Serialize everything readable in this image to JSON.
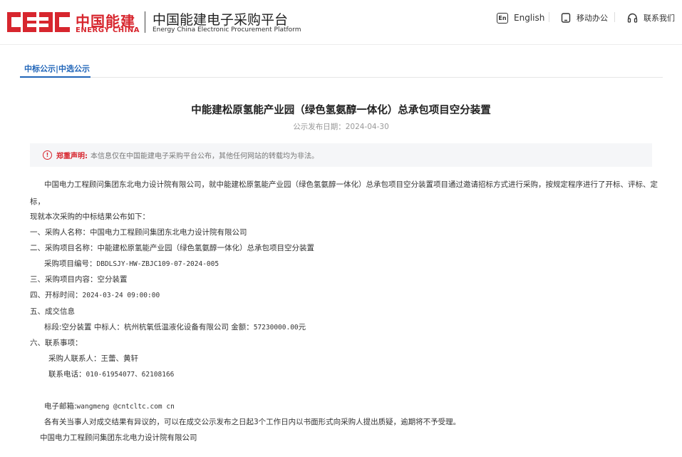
{
  "header": {
    "brand_cn": "中国能建",
    "brand_en": "ENERGY CHINA",
    "platform_cn": "中国能建电子采购平台",
    "platform_en": "Energy China Electronic Procurement Platform",
    "nav": [
      {
        "label": "English",
        "icon": "en-icon"
      },
      {
        "label": "移动办公",
        "icon": "mobile-icon"
      },
      {
        "label": "联系我们",
        "icon": "headset-icon"
      }
    ],
    "brand_color": "#d7262e"
  },
  "tabs": [
    {
      "label": "中标公示|中选公示",
      "active": true
    }
  ],
  "article": {
    "title": "中能建松原氢能产业园（绿色氢氨醇一体化）总承包项目空分装置",
    "pub_date_label": "公示发布日期：",
    "pub_date": "2024-04-30",
    "notice_label": "郑重声明:",
    "notice_text": "本信息仅在中国能建电子采购平台公布，其他任何网站的转载均为非法。",
    "intro_1": "中国电力工程顾问集团东北电力设计院有限公司，就中能建松原氢能产业园（绿色氢氨醇一体化）总承包项目空分装置项目通过邀请招标方式进行采购，按规定程序进行了开标、评标、定",
    "intro_2": "标，",
    "intro_3": "现就本次采购的中标结果公布如下：",
    "item_1": "一、采购人名称：中国电力工程顾问集团东北电力设计院有限公司",
    "item_2": "二、采购项目名称：中能建松原氢能产业园（绿色氢氨醇一体化）总承包项目空分装置",
    "item_2_code_label": "采购项目编号：",
    "item_2_code": "DBDLSJY-HW-ZBJC109-07-2024-005",
    "item_3": "三、采购项目内容：空分装置",
    "item_4_label": "四、开标时间：",
    "item_4_time": "2024-03-24 09:00:00",
    "item_5": "五、成交信息",
    "item_5_detail_a": "标段:空分装置   中标人：杭州杭氧低温液化设备有限公司 金额：",
    "item_5_amount": "57230000.00",
    "item_5_unit": "元",
    "item_6": "六、联系事项：",
    "contact_person": "采购人联系人：王蕾、黄轩",
    "contact_phone_label": "联系电话：",
    "contact_phone": "010-61954077、62108166",
    "email_label": "电子邮箱:",
    "email": "wangmeng @cntcltc.com cn",
    "objection": "各有关当事人对成交结果有异议的，可以在成交公示发布之日起3个工作日内以书面形式向采购人提出质疑，逾期将不予受理。",
    "signature": "中国电力工程顾问集团东北电力设计院有限公司"
  }
}
